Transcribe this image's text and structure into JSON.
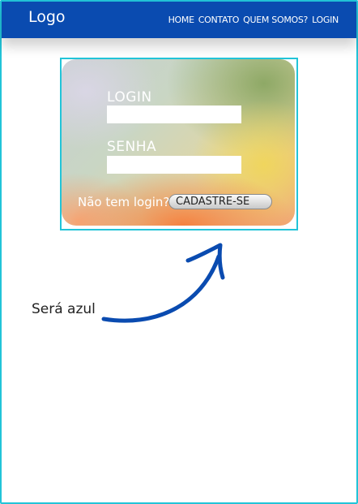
{
  "header": {
    "logo": "Logo",
    "nav": [
      "HOME",
      "CONTATO",
      "QUEM SOMOS?",
      "LOGIN"
    ]
  },
  "login_card": {
    "login_label": "LOGIN",
    "login_value": "",
    "password_label": "SENHA",
    "password_value": "",
    "signup_prompt": "Não tem login?",
    "signup_button": "CADASTRE-SE"
  },
  "annotation": {
    "note": "Será azul",
    "arrow_color": "#0a4bb0"
  },
  "colors": {
    "header_bg": "#0a4bb0",
    "frame_border": "#22c4d8"
  }
}
